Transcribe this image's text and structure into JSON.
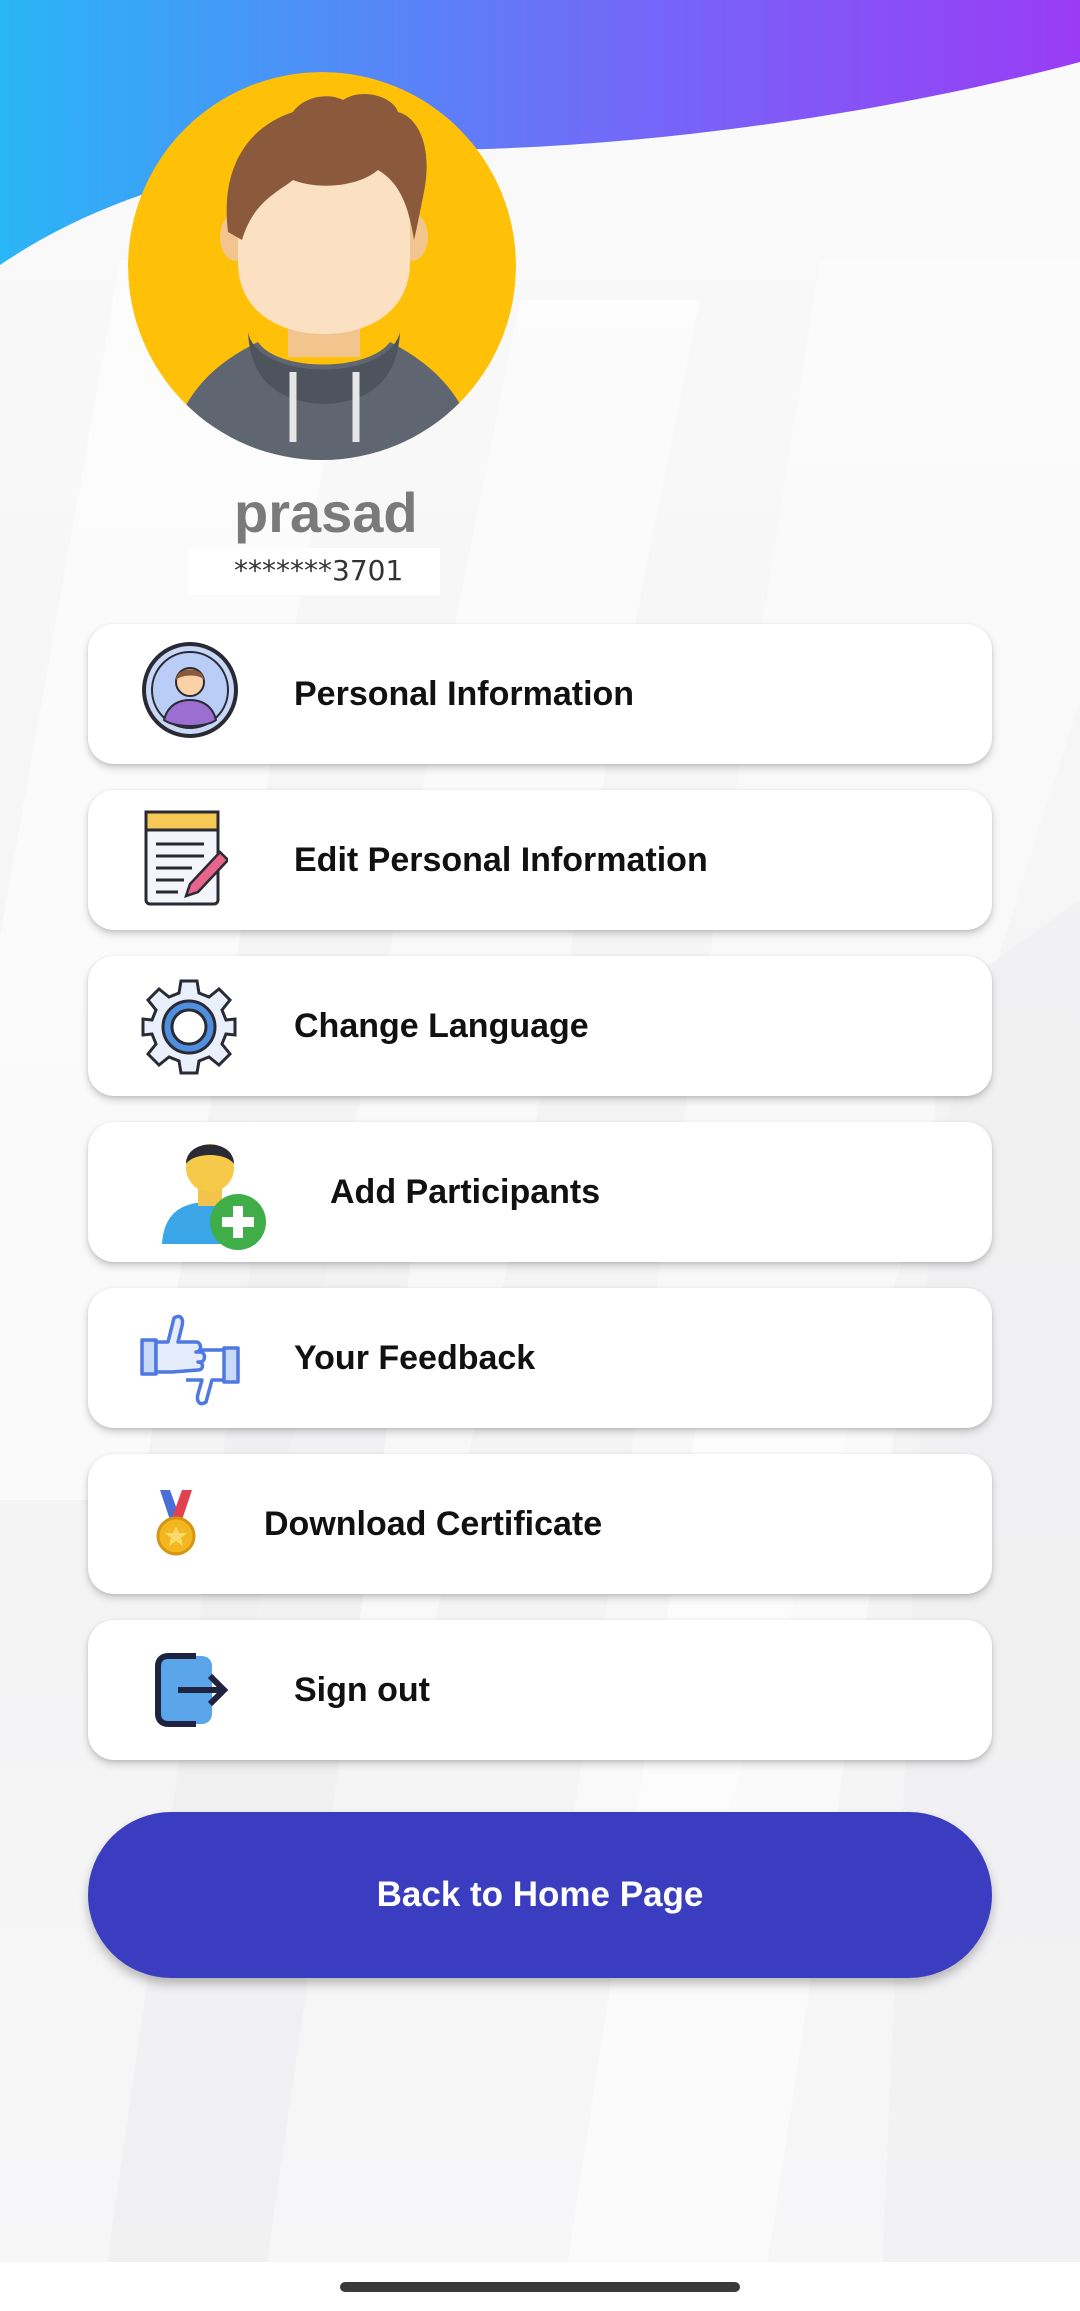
{
  "profile": {
    "name": "prasad",
    "phone_masked": "*******3701"
  },
  "menu": {
    "items": [
      {
        "label": "Personal Information",
        "icon": "user-circle-icon"
      },
      {
        "label": "Edit Personal Information",
        "icon": "notepad-pencil-icon"
      },
      {
        "label": "Change Language",
        "icon": "gear-icon"
      },
      {
        "label": "Add Participants",
        "icon": "add-user-icon"
      },
      {
        "label": "Your Feedback",
        "icon": "thumbs-up-down-icon"
      },
      {
        "label": "Download Certificate",
        "icon": "medal-icon"
      },
      {
        "label": "Sign out",
        "icon": "sign-out-icon"
      }
    ]
  },
  "actions": {
    "home_label": "Back to Home Page"
  },
  "colors": {
    "header_gradient_start": "#29b6f6",
    "header_gradient_end": "#9a3cf5",
    "avatar_background": "#ffc107",
    "primary_button": "#3a3dbf"
  }
}
